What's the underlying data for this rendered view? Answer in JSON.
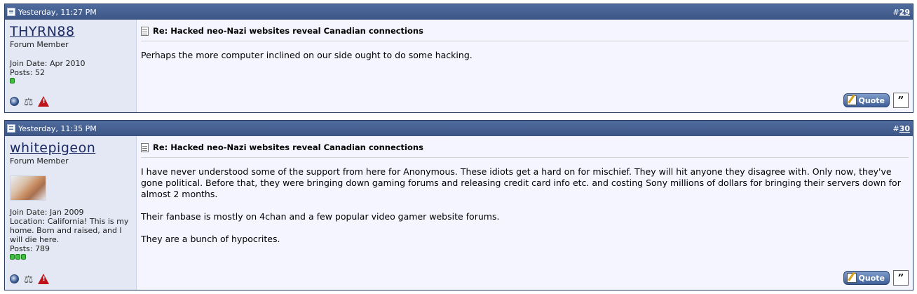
{
  "posts": [
    {
      "timestamp": "Yesterday, 11:27 PM",
      "post_number_prefix": "#",
      "post_number": "29",
      "username": "THYRN88",
      "user_title": "Forum Member",
      "join_date": "Join Date: Apr 2010",
      "location": "",
      "posts": "Posts: 52",
      "reputation_pips": 1,
      "title": "Re: Hacked neo-Nazi websites reveal Canadian connections",
      "paragraphs": [
        "Perhaps the more computer inclined on our side ought to do some hacking."
      ],
      "quote_label": "Quote"
    },
    {
      "timestamp": "Yesterday, 11:35 PM",
      "post_number_prefix": "#",
      "post_number": "30",
      "username": "whitepigeon",
      "user_title": "Forum Member",
      "join_date": "Join Date: Jan 2009",
      "location": "Location: California! This is my home. Born and raised, and I will die here.",
      "posts": "Posts: 789",
      "reputation_pips": 3,
      "title": "Re: Hacked neo-Nazi websites reveal Canadian connections",
      "paragraphs": [
        "I have never understood some of the support from here for Anonymous. These idiots get a hard on for mischief. They will hit anyone they disagree with. Only now, they've gone political. Before that, they were bringing down gaming forums and releasing credit card info etc. and costing Sony millions of dollars for bringing their servers down for almost 2 months.",
        "Their fanbase is mostly on 4chan and a few popular video gamer website forums.",
        "They are a bunch of hypocrites."
      ],
      "quote_label": "Quote"
    }
  ]
}
